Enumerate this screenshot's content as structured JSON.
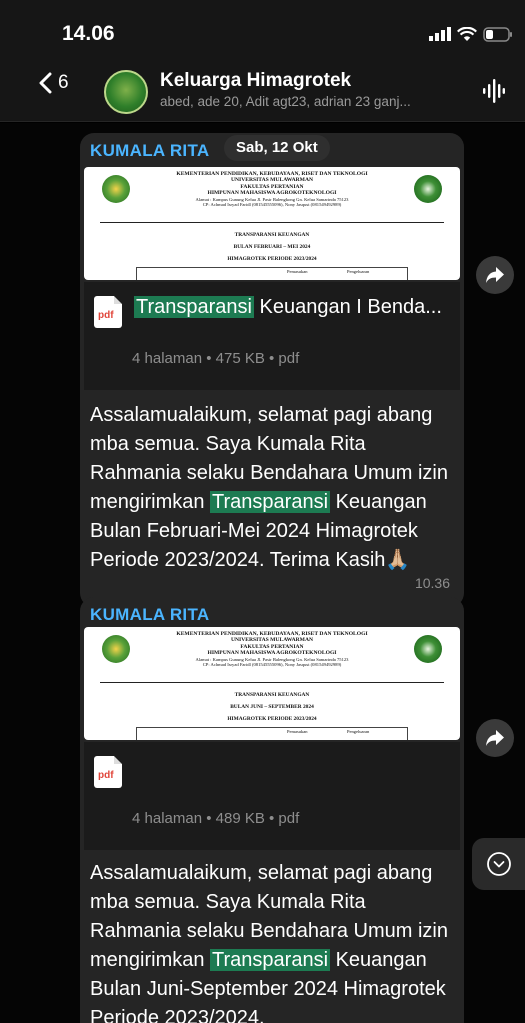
{
  "status_bar": {
    "time": "14.06"
  },
  "header": {
    "back_count": "6",
    "group_name": "Keluarga Himagrotek",
    "members": "abed, ade 20, Adit agt23, adrian 23 ganj..."
  },
  "date_pill": "Sab, 12 Okt",
  "messages": [
    {
      "sender": "KUMALA RITA",
      "doc": {
        "kop": [
          "KEMENTERIAN PENDIDIKAN, KEBUDAYAAN, RISET DAN TEKNOLOGI",
          "UNIVERSITAS MULAWARMAN",
          "FAKULTAS PERTANIAN",
          "HIMPUNAN MAHASISWA AGROKOTEKNOLOGI"
        ],
        "address": "Alamat : Kampus Gunung Kelua Jl. Pasir Balengkong Gn. Kelua Samarinda 75123",
        "contact": "CP: Achmad Isryad Faridl (081545555096), Nony Jasqust (081549492989)",
        "title_lines": [
          "TRANSPARANSI KEUANGAN",
          "BULAN FEBRUARI – MEI 2024",
          "HIMAGROTEK PERIODE 2023/2024"
        ],
        "col1": "Pemasukan",
        "col2": "Pengeluaran"
      },
      "file_icon_label": "pdf",
      "file_name_hl": "Transparansi",
      "file_name_rest": " Keuangan I Benda...",
      "file_meta": "4 halaman • 475 KB • pdf",
      "text_before": "Assalamualaikum, selamat pagi abang mba semua. Saya Kumala Rita Rahmania selaku Bendahara Umum izin mengirimkan ",
      "text_hl": "Transparansi",
      "text_after": " Keuangan Bulan Februari-Mei 2024 Himagrotek Periode 2023/2024. Terima Kasih🙏🏼",
      "time": "10.36"
    },
    {
      "sender": "KUMALA RITA",
      "doc": {
        "kop": [
          "KEMENTERIAN PENDIDIKAN, KEBUDAYAAN, RISET DAN TEKNOLOGI",
          "UNIVERSITAS MULAWARMAN",
          "FAKULTAS PERTANIAN",
          "HIMPUNAN MAHASISWA AGROKOTEKNOLOGI"
        ],
        "address": "Alamat : Kampus Gunung Kelua Jl. Pasir Balengkong Gn. Kelua Samarinda 75123",
        "contact": "CP: Achmad Isryad Faridl (081545555096), Nony Jasqust (081549492989)",
        "title_lines": [
          "TRANSPARANSI KEUANGAN",
          "BULAN JUNI – SEPTEMBER 2024",
          "HIMAGROTEK PERIODE 2023/2024"
        ],
        "col1": "Pemasukan",
        "col2": "Pengeluaran"
      },
      "file_icon_label": "pdf",
      "file_meta": "4 halaman • 489 KB • pdf",
      "text_before": "Assalamualaikum, selamat pagi abang mba semua. Saya Kumala Rita Rahmania selaku Bendahara Umum izin mengirimkan ",
      "text_hl": "Transparansi",
      "text_after": " Keuangan Bulan Juni-September 2024 Himagrotek Periode 2023/2024."
    }
  ],
  "icons": [
    "chevron-left-icon",
    "signal-icon",
    "wifi-icon",
    "battery-icon",
    "voice-chat-icon",
    "forward-icon",
    "chevron-down-icon",
    "pdf-icon"
  ]
}
